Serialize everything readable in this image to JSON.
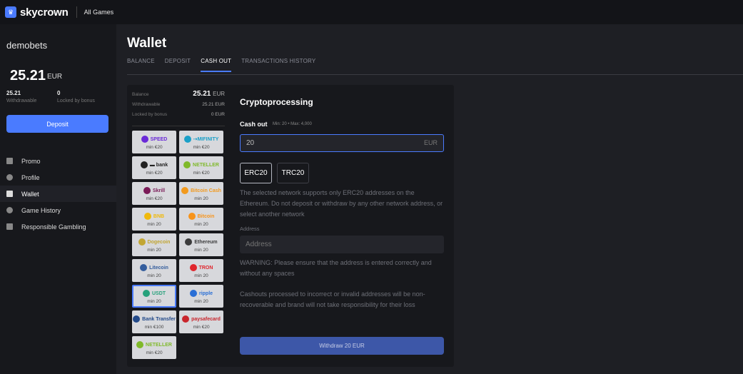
{
  "brand": {
    "name": "skycrown",
    "accent": "#4a7bff"
  },
  "topnav": {
    "all_games": "All Games"
  },
  "sidebar": {
    "username": "demobets",
    "balance": "25.21",
    "currency": "EUR",
    "withdrawable_value": "25.21",
    "withdrawable_label": "Withdrawable",
    "locked_value": "0",
    "locked_label": "Locked by bonus",
    "deposit_label": "Deposit",
    "menu": [
      {
        "label": "Promo",
        "icon": "gift-icon"
      },
      {
        "label": "Profile",
        "icon": "user-icon"
      },
      {
        "label": "Wallet",
        "icon": "wallet-icon"
      },
      {
        "label": "Game History",
        "icon": "history-icon"
      },
      {
        "label": "Responsible Gambling",
        "icon": "hand-icon"
      }
    ]
  },
  "page": {
    "title": "Wallet",
    "tabs": [
      "BALANCE",
      "DEPOSIT",
      "CASH OUT",
      "TRANSACTIONS HISTORY"
    ],
    "active_tab": "CASH OUT"
  },
  "summary": {
    "balance_label": "Balance",
    "balance_value": "25.21",
    "balance_currency": "EUR",
    "withdrawable_label": "Withdrawable",
    "withdrawable_value": "25.21 EUR",
    "locked_label": "Locked by bonus",
    "locked_value": "0 EUR"
  },
  "methods": [
    {
      "logo": "SPEED",
      "min": "min €20",
      "color": "#6a2ad8"
    },
    {
      "logo": "⇢MIFINITY",
      "min": "min €20",
      "color": "#1aa0c8"
    },
    {
      "logo": "▬ bank",
      "min": "min €20",
      "color": "#222222"
    },
    {
      "logo": "NETELLER",
      "min": "min €20",
      "color": "#7fb92a"
    },
    {
      "logo": "Skrill",
      "min": "min €20",
      "color": "#7a1a57"
    },
    {
      "logo": "Bitcoin Cash",
      "min": "min 20",
      "color": "#f29a1e"
    },
    {
      "logo": "BNB",
      "min": "min 20",
      "color": "#f0b90b"
    },
    {
      "logo": "Bitcoin",
      "min": "min 20",
      "color": "#f7931a"
    },
    {
      "logo": "Dogecoin",
      "min": "min 20",
      "color": "#c2a633"
    },
    {
      "logo": "Ethereum",
      "min": "min 20",
      "color": "#3c3c3d"
    },
    {
      "logo": "Litecoin",
      "min": "min 20",
      "color": "#345d9d"
    },
    {
      "logo": "TRON",
      "min": "min 20",
      "color": "#e0262d"
    },
    {
      "logo": "USDT",
      "min": "min 20",
      "color": "#26a17b"
    },
    {
      "logo": "ripple",
      "min": "min 20",
      "color": "#2a6fd6"
    },
    {
      "logo": "Bank Transfer",
      "min": "min €100",
      "color": "#234a8a"
    },
    {
      "logo": "paysafecard",
      "min": "min €20",
      "color": "#c9262d"
    },
    {
      "logo": "NETELLER",
      "min": "min €20",
      "color": "#7fb92a"
    }
  ],
  "cashout": {
    "title": "Cryptoprocessing",
    "label": "Cash out",
    "limits": "Min: 20 • Max: 4,000",
    "amount": "20",
    "currency": "EUR",
    "networks": [
      "ERC20",
      "TRC20"
    ],
    "selected_network": "ERC20",
    "network_note": "The selected network supports only ERC20 addresses on the Ethereum. Do not deposit or withdraw by any other network address, or select another network",
    "address_label": "Address",
    "address_placeholder": "Address",
    "warning": "WARNING: Please ensure that the address is entered correctly and without any spaces",
    "disclaimer": "Cashouts processed to incorrect or invalid addresses will be non-recoverable and brand will not take responsibility for their loss",
    "withdraw_label": "Withdraw 20 EUR"
  }
}
